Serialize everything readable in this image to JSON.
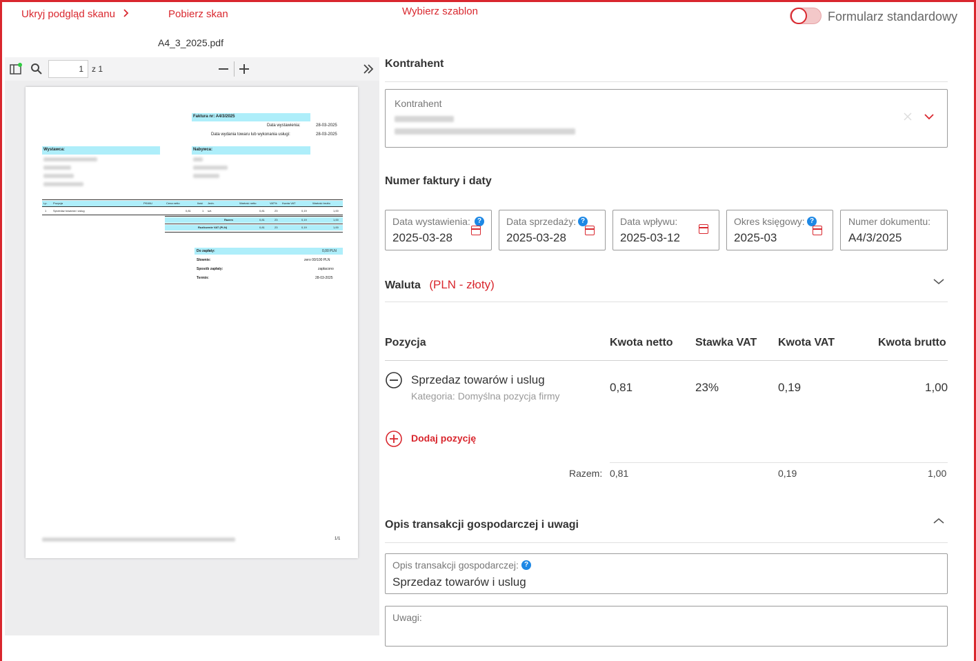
{
  "topbar": {
    "hide_preview": "Ukryj podgląd skanu",
    "download_scan": "Pobierz skan",
    "choose_template": "Wybierz szablon",
    "standard_form": "Formularz standardowy"
  },
  "viewer": {
    "filename": "A4_3_2025.pdf",
    "page_current": "1",
    "page_total": "z 1"
  },
  "pdf": {
    "invoice_no": "Faktura nr: A4/3/2025",
    "issue_date_label": "Data wystawienia:",
    "issue_date": "28-03-2025",
    "delivery_label": "Data wydania towaru lub wykonania usługi:",
    "delivery_date": "28-03-2025",
    "seller": "Wystawca:",
    "buyer": "Nabywca:",
    "table_headers": [
      "Lp.",
      "Pozycja",
      "PKWiU",
      "Cena netto",
      "Ilość",
      "Jedn.",
      "Wartość netto",
      "VAT%",
      "Kwota VAT",
      "Wartość brutto"
    ],
    "row": [
      "1",
      "Sprzedaz towarów i uslug",
      "0,81",
      "1",
      "szt.",
      "0,81",
      "23",
      "0,19",
      "1,00"
    ],
    "razem": "Razem",
    "razem_vals": [
      "0,81",
      "23",
      "0,19",
      "1,00"
    ],
    "rozliczenie": "Rozliczenie VAT (PLN)",
    "rozliczenie_vals": [
      "0,81",
      "23",
      "0,19",
      "1,00"
    ],
    "do_zaplaty": "Do zapłaty:",
    "do_zaplaty_val": "0,00 PLN",
    "slownie": "Słownie:",
    "slownie_val": "zero 00/100 PLN",
    "sposob": "Sposób zapłaty:",
    "sposob_val": "zapłacono",
    "termin": "Termin:",
    "termin_val": "28-03-2025",
    "page_no": "1/1"
  },
  "form": {
    "kontrahent_title": "Kontrahent",
    "kontrahent_label": "Kontrahent",
    "invoice_dates_title": "Numer faktury i daty",
    "dates": [
      {
        "label": "Data wystawienia:",
        "value": "2025-03-28"
      },
      {
        "label": "Data sprzedaży:",
        "value": "2025-03-28"
      },
      {
        "label": "Data wpływu:",
        "value": "2025-03-12"
      },
      {
        "label": "Okres księgowy:",
        "value": "2025-03"
      },
      {
        "label": "Numer dokumentu:",
        "value": "A4/3/2025"
      }
    ],
    "currency_label": "Waluta",
    "currency_value": "(PLN - złoty)",
    "table": {
      "headers": [
        "Pozycja",
        "Kwota netto",
        "Stawka VAT",
        "Kwota VAT",
        "Kwota brutto"
      ],
      "item_name": "Sprzedaz towarów i uslug",
      "item_category": "Kategoria: Domyślna pozycja firmy",
      "item_netto": "0,81",
      "item_vat_rate": "23%",
      "item_vat": "0,19",
      "item_brutto": "1,00",
      "add_position": "Dodaj pozycję",
      "total_label": "Razem:",
      "total_netto": "0,81",
      "total_vat": "0,19",
      "total_brutto": "1,00"
    },
    "description_title": "Opis transakcji gospodarczej i uwagi",
    "description_label": "Opis transakcji gospodarczej:",
    "description_value": "Sprzedaz towarów i uslug",
    "notes_label": "Uwagi:"
  },
  "colors": {
    "accent": "#d9272e",
    "help": "#1e88e5",
    "pdf_highlight": "#aeeefa"
  }
}
